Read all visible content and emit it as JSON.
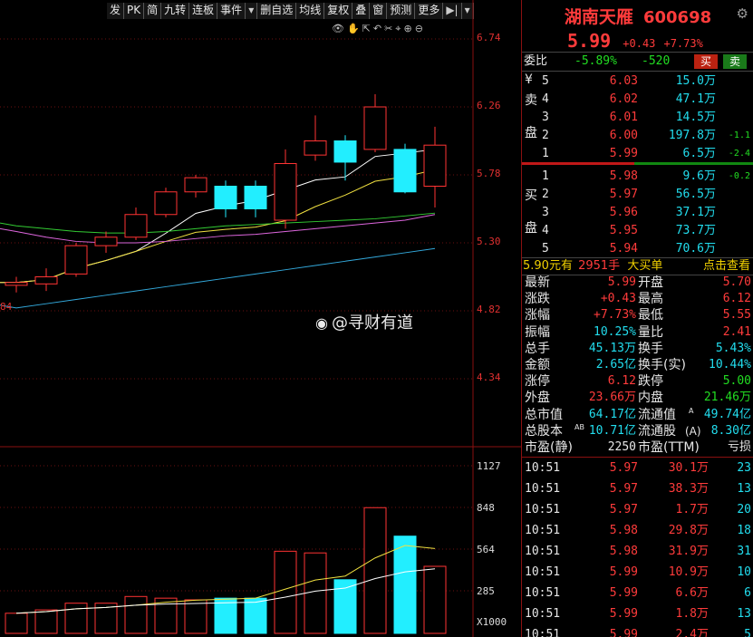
{
  "toolbar": {
    "buttons": [
      "发",
      "PK",
      "简",
      "九转",
      "连板",
      "事件",
      "▾",
      "删自选",
      "均线",
      "复权",
      "叠",
      "窗",
      "预测",
      "更多",
      "▶|",
      "▾"
    ]
  },
  "chart_tools": {
    "icons": [
      "eye-icon",
      "hand-icon",
      "cursor-icon",
      "undo-icon",
      "scissors-icon",
      "crosshair-icon",
      "zoom-in-icon",
      "zoom-out-icon"
    ]
  },
  "price_axis": [
    "6.74",
    "6.26",
    "5.78",
    "5.30",
    "4.82",
    "4.34"
  ],
  "price_axis_low_label": "84",
  "volume_axis": [
    "1127",
    "848",
    "564",
    "285",
    "X1000"
  ],
  "watermark": "@寻财有道",
  "candles": [
    {
      "o": 5.0,
      "c": 5.02,
      "h": 5.06,
      "l": 4.95
    },
    {
      "o": 5.01,
      "c": 5.06,
      "h": 5.12,
      "l": 4.96
    },
    {
      "o": 5.08,
      "c": 5.28,
      "h": 5.3,
      "l": 5.06
    },
    {
      "o": 5.28,
      "c": 5.34,
      "h": 5.38,
      "l": 5.23
    },
    {
      "o": 5.34,
      "c": 5.5,
      "h": 5.55,
      "l": 5.32
    },
    {
      "o": 5.5,
      "c": 5.66,
      "h": 5.69,
      "l": 5.48
    },
    {
      "o": 5.66,
      "c": 5.76,
      "h": 5.78,
      "l": 5.62
    },
    {
      "o": 5.7,
      "c": 5.54,
      "h": 5.74,
      "l": 5.48
    },
    {
      "o": 5.7,
      "c": 5.54,
      "h": 5.74,
      "l": 5.48
    },
    {
      "o": 5.46,
      "c": 5.86,
      "h": 5.96,
      "l": 5.4
    },
    {
      "o": 5.92,
      "c": 6.02,
      "h": 6.2,
      "l": 5.88
    },
    {
      "o": 6.02,
      "c": 5.87,
      "h": 6.06,
      "l": 5.74
    },
    {
      "o": 5.96,
      "c": 6.26,
      "h": 6.35,
      "l": 5.94
    },
    {
      "o": 5.96,
      "c": 5.66,
      "h": 6.0,
      "l": 5.65
    },
    {
      "o": 5.7,
      "c": 5.99,
      "h": 6.12,
      "l": 5.55
    }
  ],
  "volumes": [
    0.12,
    0.14,
    0.18,
    0.18,
    0.22,
    0.21,
    0.2,
    0.21,
    0.21,
    0.49,
    0.48,
    0.32,
    0.75,
    0.58,
    0.4
  ],
  "header": {
    "name": "湖南天雁",
    "code": "600698",
    "price": "5.99",
    "change": "+0.43",
    "pct": "+7.73%"
  },
  "weibi": {
    "label": "委比",
    "pct": "-5.89%",
    "diff": "-520",
    "buy": "买",
    "sell": "卖"
  },
  "sell_side": {
    "labels": [
      "¥",
      "卖",
      "盘"
    ],
    "rows": [
      {
        "lvl": "5",
        "p": "6.03",
        "v": "15.0万",
        "d": ""
      },
      {
        "lvl": "4",
        "p": "6.02",
        "v": "47.1万",
        "d": ""
      },
      {
        "lvl": "3",
        "p": "6.01",
        "v": "14.5万",
        "d": ""
      },
      {
        "lvl": "2",
        "p": "6.00",
        "v": "197.8万",
        "d": "-1.1"
      },
      {
        "lvl": "1",
        "p": "5.99",
        "v": "6.5万",
        "d": "-2.4"
      }
    ]
  },
  "buy_side": {
    "labels": [
      "买",
      "盘"
    ],
    "rows": [
      {
        "lvl": "1",
        "p": "5.98",
        "v": "9.6万",
        "d": "-0.2"
      },
      {
        "lvl": "2",
        "p": "5.97",
        "v": "56.5万",
        "d": ""
      },
      {
        "lvl": "3",
        "p": "5.96",
        "v": "37.1万",
        "d": ""
      },
      {
        "lvl": "4",
        "p": "5.95",
        "v": "73.7万",
        "d": ""
      },
      {
        "lvl": "5",
        "p": "5.94",
        "v": "70.6万",
        "d": ""
      }
    ]
  },
  "big_order": {
    "price": "5.90元有",
    "hands": "2951手",
    "label": "大买单",
    "link": "点击查看"
  },
  "stats": [
    {
      "l1": "最新",
      "v1": "5.99",
      "c1": "red",
      "l2": "开盘",
      "v2": "5.70",
      "c2": "red"
    },
    {
      "l1": "涨跌",
      "v1": "+0.43",
      "c1": "red",
      "l2": "最高",
      "v2": "6.12",
      "c2": "red"
    },
    {
      "l1": "涨幅",
      "v1": "+7.73%",
      "c1": "red",
      "l2": "最低",
      "v2": "5.55",
      "c2": "red"
    },
    {
      "l1": "振幅",
      "v1": "10.25%",
      "c1": "cyan",
      "l2": "量比",
      "v2": "2.41",
      "c2": "red"
    },
    {
      "l1": "总手",
      "v1": "45.13万",
      "c1": "cyan",
      "l2": "换手",
      "v2": "5.43%",
      "c2": "cyan"
    },
    {
      "l1": "金额",
      "v1": "2.65亿",
      "c1": "cyan",
      "l2": "换手(实)",
      "v2": "10.44%",
      "c2": "cyan"
    },
    {
      "l1": "涨停",
      "v1": "6.12",
      "c1": "red",
      "l2": "跌停",
      "v2": "5.00",
      "c2": "green"
    },
    {
      "l1": "外盘",
      "v1": "23.66万",
      "c1": "red",
      "l2": "内盘",
      "v2": "21.46万",
      "c2": "green"
    },
    {
      "l1": "总市值",
      "v1": "64.17亿",
      "c1": "cyan",
      "l2": "流通值",
      "v2": "49.74亿",
      "c2": "cyan",
      "sup2": "A"
    },
    {
      "l1": "总股本",
      "v1": "10.71亿",
      "c1": "cyan",
      "l2": "流通股",
      "v2": "8.30亿",
      "c2": "cyan",
      "sup1": "AB",
      "mid2": "(A)"
    },
    {
      "l1": "市盈(静)",
      "v1": "2250",
      "c1": "white",
      "l2": "市盈(TTM)",
      "v2": "亏损",
      "c2": "white"
    }
  ],
  "ticks": [
    {
      "t": "10:51",
      "p": "5.97",
      "v": "30.1万",
      "n": "23"
    },
    {
      "t": "10:51",
      "p": "5.97",
      "v": "38.3万",
      "n": "13"
    },
    {
      "t": "10:51",
      "p": "5.97",
      "v": "1.7万",
      "n": "20"
    },
    {
      "t": "10:51",
      "p": "5.98",
      "v": "29.8万",
      "n": "18"
    },
    {
      "t": "10:51",
      "p": "5.98",
      "v": "31.9万",
      "n": "31"
    },
    {
      "t": "10:51",
      "p": "5.99",
      "v": "10.9万",
      "n": "10"
    },
    {
      "t": "10:51",
      "p": "5.99",
      "v": "6.6万",
      "n": "6"
    },
    {
      "t": "10:51",
      "p": "5.99",
      "v": "1.8万",
      "n": "13"
    },
    {
      "t": "10:51",
      "p": "5.99",
      "v": "2.4万",
      "n": "5"
    }
  ],
  "colors": {
    "up": "#ff3333",
    "down": "#22eeff",
    "ma5": "#ffffff",
    "ma10": "#f0e040",
    "ma20": "#33cc33",
    "ma30": "#dd66dd",
    "ma60": "#33aadd"
  }
}
